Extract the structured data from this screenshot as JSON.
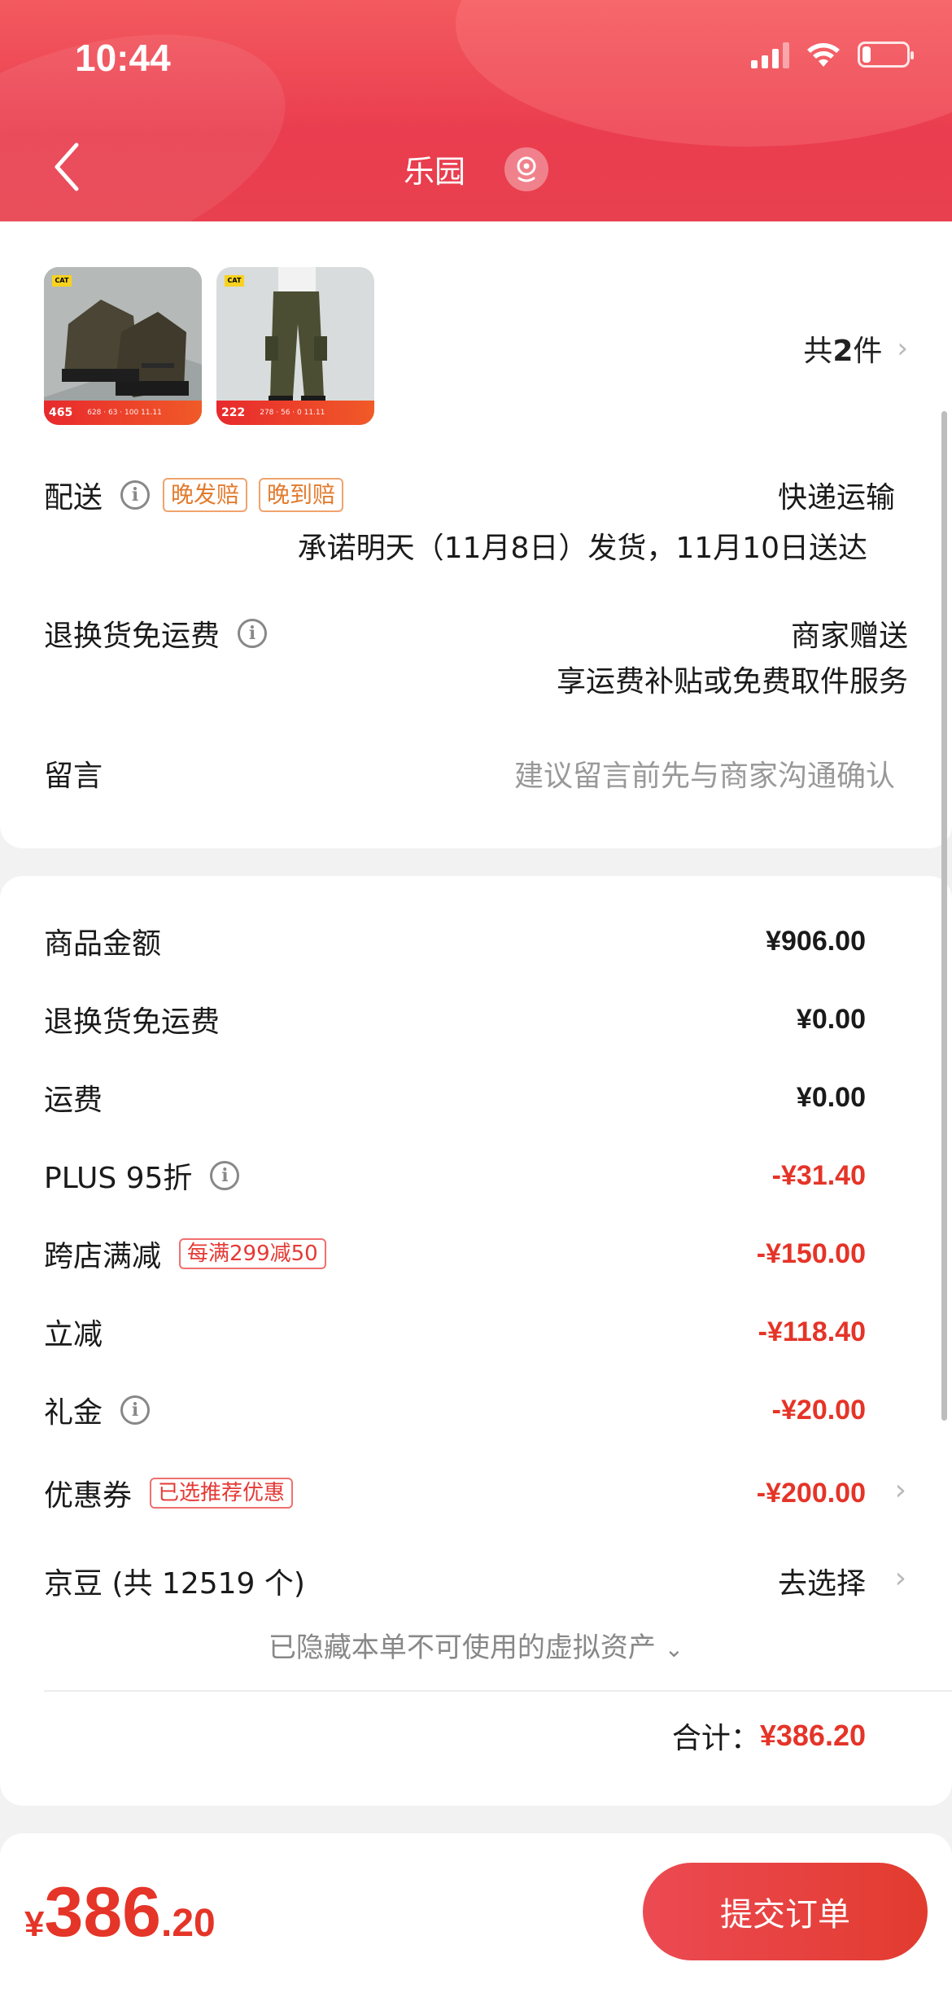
{
  "status_bar": {
    "time": "10:44",
    "battery_level": 0.2
  },
  "nav": {
    "title": "乐园"
  },
  "products": {
    "items": [
      {
        "name": "boots",
        "brand_badge": "CAT",
        "strip_price": "465",
        "strip_mini": "628 · 63 · 100 11.11"
      },
      {
        "name": "pants",
        "brand_badge": "CAT",
        "strip_price": "222",
        "strip_mini": "278 · 56 · 0 11.11"
      }
    ],
    "count_prefix": "共",
    "count": "2",
    "count_suffix": "件"
  },
  "delivery": {
    "label": "配送",
    "tag_late_ship": "晚发赔",
    "tag_late_arrive": "晚到赔",
    "method": "快递运输",
    "promise": "承诺明天（11月8日）发货，11月10日送达"
  },
  "return_shipping": {
    "label": "退换货免运费",
    "value": "商家赠送",
    "desc": "享运费补贴或免费取件服务"
  },
  "message": {
    "label": "留言",
    "placeholder": "建议留言前先与商家沟通确认"
  },
  "summary": {
    "rows": [
      {
        "label": "商品金额",
        "value": "¥906.00",
        "red": false
      },
      {
        "label": "退换货免运费",
        "value": "¥0.00",
        "red": false
      },
      {
        "label": "运费",
        "value": "¥0.00",
        "red": false
      },
      {
        "label": "PLUS 95折",
        "value": "-¥31.40",
        "red": true
      },
      {
        "label": "跨店满减",
        "tag": "每满299减50",
        "value": "-¥150.00",
        "red": true
      },
      {
        "label": "立减",
        "value": "-¥118.40",
        "red": true
      },
      {
        "label": "礼金",
        "value": "-¥20.00",
        "red": true
      },
      {
        "label": "优惠券",
        "tag": "已选推荐优惠",
        "value": "-¥200.00",
        "red": true
      }
    ],
    "jingdou": {
      "label": "京豆 (共 12519 个)",
      "action": "去选择"
    },
    "hidden_note": "已隐藏本单不可使用的虚拟资产",
    "total_label": "合计：",
    "total_value": "¥386.20"
  },
  "bottom": {
    "currency": "¥",
    "price_int": "386",
    "price_dec": ".20",
    "submit_label": "提交订单"
  },
  "colors": {
    "accent_red": "#e53428",
    "header_red": "#ea3d4f",
    "tag_orange": "#e27b2e"
  }
}
